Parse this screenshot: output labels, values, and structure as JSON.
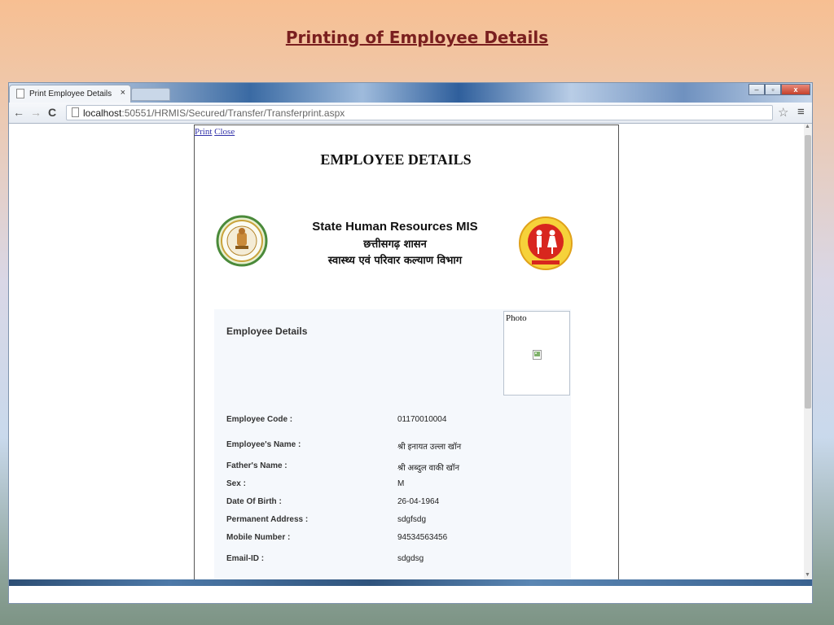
{
  "slide": {
    "title": "Printing of Employee Details"
  },
  "browser": {
    "tab_title": "Print Employee Details",
    "tab_close": "×",
    "url_host": "localhost",
    "url_path": ":50551/HRMIS/Secured/Transfer/Transferprint.aspx",
    "back": "←",
    "forward": "→",
    "reload": "C",
    "star": "☆",
    "menu": "≡",
    "win_min": "–",
    "win_max": "▫",
    "win_close": "x"
  },
  "doc": {
    "print_link": "Print",
    "close_link": "Close",
    "heading": "EMPLOYEE DETAILS",
    "org_en": "State Human Resources MIS",
    "org_hi1": "छत्तीसगढ़ शासन",
    "org_hi2": "स्वास्थ्य एवं परिवार कल्याण विभाग",
    "emblem_left_icon": "chhattisgarh-govt-emblem-icon",
    "emblem_right_icon": "nrhm-logo-icon"
  },
  "panel": {
    "title": "Employee Details",
    "photo_label": "Photo",
    "rows": [
      {
        "label": "Employee Code :",
        "value": "01170010004"
      },
      {
        "label": "Employee's Name :",
        "value": "श्री इनायत उल्ला खॉन"
      },
      {
        "label": "Father's Name :",
        "value": "श्री अब्दुल वाकी खॉन"
      },
      {
        "label": "Sex :",
        "value": "M"
      },
      {
        "label": "Date Of Birth :",
        "value": "26-04-1964"
      },
      {
        "label": "Permanent Address :",
        "value": "sdgfsdg"
      },
      {
        "label": "Mobile Number :",
        "value": "94534563456"
      },
      {
        "label": "Email-ID :",
        "value": "sdgdsg"
      }
    ]
  }
}
